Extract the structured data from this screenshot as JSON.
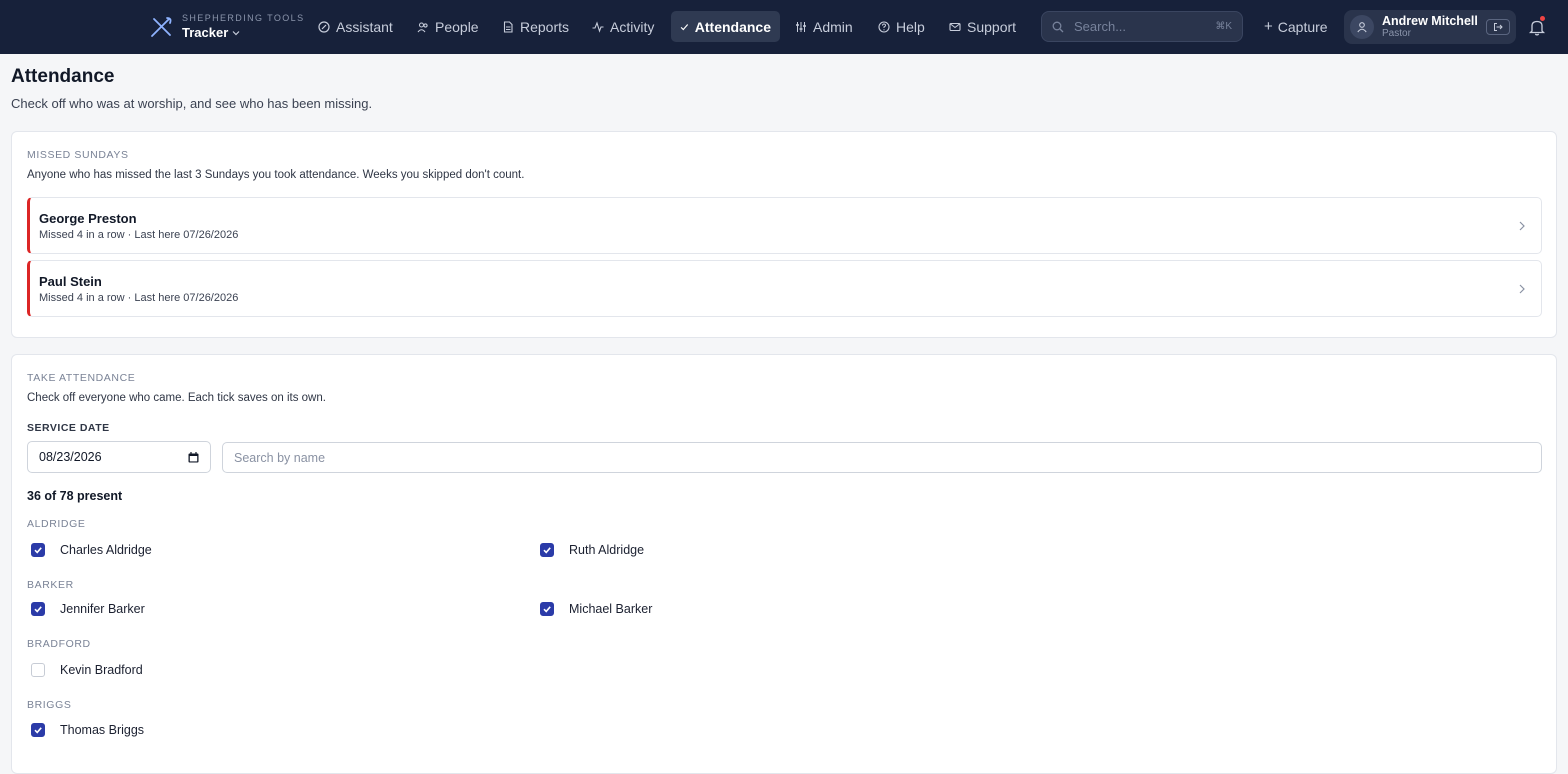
{
  "brand": {
    "small": "SHEPHERDING TOOLS",
    "name": "Tracker"
  },
  "nav": [
    {
      "label": "Assistant",
      "icon": "assistant-icon",
      "active": false
    },
    {
      "label": "People",
      "icon": "people-icon",
      "active": false
    },
    {
      "label": "Reports",
      "icon": "reports-icon",
      "active": false
    },
    {
      "label": "Activity",
      "icon": "activity-icon",
      "active": false
    },
    {
      "label": "Attendance",
      "icon": "check-icon",
      "active": true
    },
    {
      "label": "Admin",
      "icon": "sliders-icon",
      "active": false
    },
    {
      "label": "Help",
      "icon": "help-icon",
      "active": false
    },
    {
      "label": "Support",
      "icon": "mail-icon",
      "active": false
    }
  ],
  "search": {
    "placeholder": "Search...",
    "shortcut": "⌘K"
  },
  "capture_label": "Capture",
  "user": {
    "name": "Andrew Mitchell",
    "role": "Pastor"
  },
  "colors": {
    "nav_bg": "#17213a",
    "accent": "#2b3ba8",
    "missed_marker": "#dc2626",
    "notification_dot": "#ef4444"
  },
  "page": {
    "title": "Attendance",
    "subtitle": "Check off who was at worship, and see who has been missing."
  },
  "missed": {
    "label": "MISSED SUNDAYS",
    "description": "Anyone who has missed the last 3 Sundays you took attendance. Weeks you skipped don't count.",
    "people": [
      {
        "name": "George Preston",
        "detail": "Missed 4 in a row · Last here 07/26/2026"
      },
      {
        "name": "Paul Stein",
        "detail": "Missed 4 in a row · Last here 07/26/2026"
      }
    ]
  },
  "take": {
    "label": "TAKE ATTENDANCE",
    "description": "Check off everyone who came. Each tick saves on its own.",
    "date_label": "SERVICE DATE",
    "date_value": "08/23/2026",
    "search_placeholder": "Search by name",
    "present_count": "36 of 78 present",
    "families": [
      {
        "name": "ALDRIDGE",
        "members": [
          {
            "name": "Charles Aldridge",
            "checked": true
          },
          {
            "name": "Ruth Aldridge",
            "checked": true
          }
        ]
      },
      {
        "name": "BARKER",
        "members": [
          {
            "name": "Jennifer Barker",
            "checked": true
          },
          {
            "name": "Michael Barker",
            "checked": true
          }
        ]
      },
      {
        "name": "BRADFORD",
        "members": [
          {
            "name": "Kevin Bradford",
            "checked": false
          }
        ]
      },
      {
        "name": "BRIGGS",
        "members": [
          {
            "name": "Thomas Briggs",
            "checked": true
          }
        ]
      }
    ]
  }
}
